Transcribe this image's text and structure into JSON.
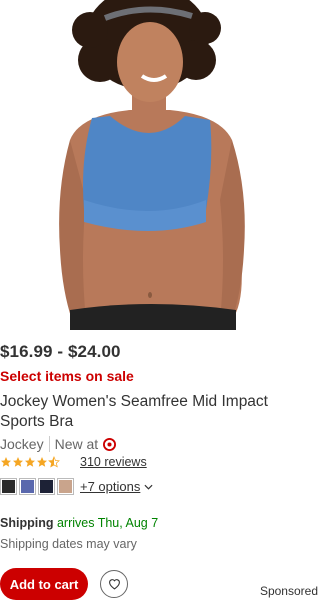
{
  "product": {
    "image_alt": "Woman wearing blue sports bra",
    "price": "$16.99 - $24.00",
    "sale_text": "Select items on sale",
    "title": "Jockey Women's Seamfree Mid Impact Sports Bra",
    "brand": "Jockey",
    "new_at": "New at",
    "rating": 4.5,
    "reviews_text": "310 reviews",
    "more_options": "+7 options"
  },
  "swatches": [
    {
      "color": "#2a2a2a"
    },
    {
      "color": "#5a68ad"
    },
    {
      "color": "#1d2236"
    },
    {
      "color": "#c9a48c"
    }
  ],
  "shipping": {
    "label": "Shipping",
    "date": "arrives Thu, Aug 7",
    "note": "Shipping dates may vary"
  },
  "actions": {
    "add_to_cart": "Add to cart"
  },
  "sponsored": "Sponsored",
  "colors": {
    "brand_red": "#cc0000",
    "ship_green": "#008300",
    "star": "#f5a623"
  }
}
